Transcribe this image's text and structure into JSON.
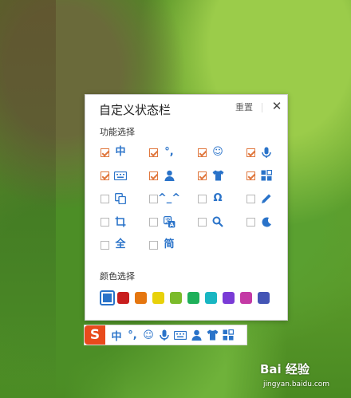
{
  "panel": {
    "title": "自定义状态栏",
    "reset_label": "重置",
    "close_glyph": "✕",
    "functions_label": "功能选择",
    "colors_label": "颜色选择"
  },
  "options": [
    {
      "name": "chinese-mode",
      "glyph": "中",
      "checked": true
    },
    {
      "name": "punctuation",
      "glyph": "°,",
      "checked": true
    },
    {
      "name": "emoji",
      "glyph": "☺",
      "checked": true
    },
    {
      "name": "voice",
      "glyph": "mic",
      "checked": true
    },
    {
      "name": "keyboard",
      "glyph": "kbd",
      "checked": true
    },
    {
      "name": "user",
      "glyph": "user",
      "checked": true
    },
    {
      "name": "skin",
      "glyph": "shirt",
      "checked": true
    },
    {
      "name": "toolbox",
      "glyph": "grid",
      "checked": true
    },
    {
      "name": "copy",
      "glyph": "copy",
      "checked": false
    },
    {
      "name": "emoticon",
      "glyph": "^_^",
      "checked": false
    },
    {
      "name": "headphones",
      "glyph": "Ω",
      "checked": false
    },
    {
      "name": "handwriting",
      "glyph": "pen",
      "checked": false
    },
    {
      "name": "crop",
      "glyph": "crop",
      "checked": false
    },
    {
      "name": "translate",
      "glyph": "trans",
      "checked": false
    },
    {
      "name": "search",
      "glyph": "search",
      "checked": false
    },
    {
      "name": "night-mode",
      "glyph": "moon",
      "checked": false
    },
    {
      "name": "full-width",
      "glyph": "全",
      "checked": false
    },
    {
      "name": "simplified",
      "glyph": "简",
      "checked": false
    }
  ],
  "colors": [
    "#2a73c9",
    "#c81e1e",
    "#e5760f",
    "#e8d10a",
    "#7bbb2b",
    "#1fb05a",
    "#19b6c2",
    "#7a3bd6",
    "#c43aa5",
    "#4455b5"
  ],
  "selected_color_index": 0,
  "toolbar": {
    "logo": "S",
    "items": [
      "中",
      "°,",
      "☺",
      "mic",
      "kbd",
      "user",
      "shirt",
      "grid"
    ]
  },
  "watermark": {
    "brand": "Bai 经验",
    "url": "jingyan.baidu.com"
  }
}
